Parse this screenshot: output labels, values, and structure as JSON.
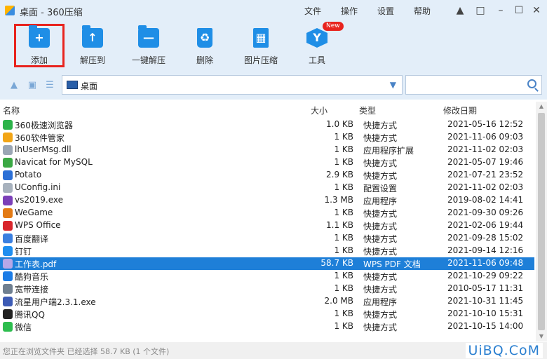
{
  "window": {
    "title": "桌面 - 360压缩",
    "menu": [
      "文件",
      "操作",
      "设置",
      "帮助"
    ],
    "controls": [
      "shirt-icon",
      "feedback-icon",
      "minimize-icon",
      "maximize-icon",
      "close-icon"
    ]
  },
  "toolbar": {
    "items": [
      {
        "label": "添加",
        "icon": "add-folder-icon",
        "highlighted": true
      },
      {
        "label": "解压到",
        "icon": "extract-to-icon"
      },
      {
        "label": "一键解压",
        "icon": "one-click-extract-icon"
      },
      {
        "label": "删除",
        "icon": "recycle-bin-icon"
      },
      {
        "label": "图片压缩",
        "icon": "image-compress-icon"
      },
      {
        "label": "工具",
        "icon": "tools-icon",
        "badge": "New"
      }
    ]
  },
  "address": {
    "path": "桌面",
    "search_placeholder": ""
  },
  "columns": {
    "name": "名称",
    "size": "大小",
    "type": "类型",
    "date": "修改日期"
  },
  "files": [
    {
      "name": "360极速浏览器",
      "size": "1.0 KB",
      "type": "快捷方式",
      "date": "2021-05-16 12:52",
      "color": "#2db34a"
    },
    {
      "name": "360软件管家",
      "size": "1 KB",
      "type": "快捷方式",
      "date": "2021-11-06 09:03",
      "color": "#f2a516"
    },
    {
      "name": "lhUserMsg.dll",
      "size": "1 KB",
      "type": "应用程序扩展",
      "date": "2021-11-02 02:03",
      "color": "#9aa6b4"
    },
    {
      "name": "Navicat for MySQL",
      "size": "1 KB",
      "type": "快捷方式",
      "date": "2021-05-07 19:46",
      "color": "#3aa843"
    },
    {
      "name": "Potato",
      "size": "2.9 KB",
      "type": "快捷方式",
      "date": "2021-07-21 23:52",
      "color": "#2b6fd6"
    },
    {
      "name": "UConfig.ini",
      "size": "1 KB",
      "type": "配置设置",
      "date": "2021-11-02 02:03",
      "color": "#a7b1bd"
    },
    {
      "name": "vs2019.exe",
      "size": "1.3 MB",
      "type": "应用程序",
      "date": "2019-08-02 14:41",
      "color": "#7b3fb8"
    },
    {
      "name": "WeGame",
      "size": "1 KB",
      "type": "快捷方式",
      "date": "2021-09-30 09:26",
      "color": "#e37a14"
    },
    {
      "name": "WPS Office",
      "size": "1.1 KB",
      "type": "快捷方式",
      "date": "2021-02-06 19:44",
      "color": "#d8252b"
    },
    {
      "name": "百度翻译",
      "size": "1 KB",
      "type": "快捷方式",
      "date": "2021-09-28 15:02",
      "color": "#3a7fe0"
    },
    {
      "name": "钉钉",
      "size": "1 KB",
      "type": "快捷方式",
      "date": "2021-09-14 12:16",
      "color": "#1e8ef0"
    },
    {
      "name": "工作表.pdf",
      "size": "58.7 KB",
      "type": "WPS PDF 文档",
      "date": "2021-11-06 09:48",
      "color": "#b6a7e8",
      "selected": true
    },
    {
      "name": "酷狗音乐",
      "size": "1 KB",
      "type": "快捷方式",
      "date": "2021-10-29 09:22",
      "color": "#1c7ce6"
    },
    {
      "name": "宽带连接",
      "size": "1 KB",
      "type": "快捷方式",
      "date": "2010-05-17 11:31",
      "color": "#6f7f90"
    },
    {
      "name": "流星用户端2.3.1.exe",
      "size": "2.0 MB",
      "type": "应用程序",
      "date": "2021-10-31 11:45",
      "color": "#3c5bb5"
    },
    {
      "name": "腾讯QQ",
      "size": "1 KB",
      "type": "快捷方式",
      "date": "2021-10-10 15:31",
      "color": "#222222"
    },
    {
      "name": "微信",
      "size": "1 KB",
      "type": "快捷方式",
      "date": "2021-10-15 14:00",
      "color": "#2dbd4e"
    }
  ],
  "status": "您正在浏览文件夹 已经选择 58.7 KB (1 个文件)",
  "watermark": "UiBQ.CoM"
}
